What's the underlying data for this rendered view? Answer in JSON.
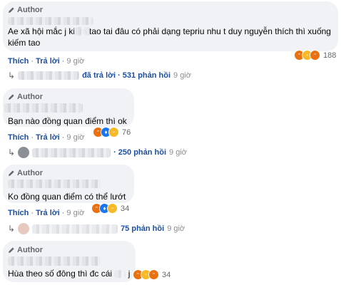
{
  "comments": [
    {
      "author": "Author",
      "text": "Ae xã hội mắc      j kiếm tao tai đâu có phải dạng tepriu nhu t duy nguyễn thích thì xuống kiếm tao",
      "like_label": "Thích",
      "reply_label": "Trả lời",
      "time": "9 giờ",
      "reaction_count": "188",
      "reactions": [
        "angry-icon",
        "haha-icon",
        "angry-icon"
      ],
      "reply_summary": "đã trả lời · 531 phản hồi",
      "reply_time": "9 giờ"
    },
    {
      "author": "Author",
      "text": "Bạn nào đồng quan điểm thì ok",
      "like_label": "Thích",
      "reply_label": "Trả lời",
      "time": "9 giờ",
      "reaction_count": "76",
      "reactions": [
        "angry-icon",
        "like-icon",
        "haha-icon"
      ],
      "reply_summary": "· 250 phản hồi",
      "reply_time": "9 giờ"
    },
    {
      "author": "Author",
      "text": "Ko đồng quan điểm có thể lướt",
      "like_label": "Thích",
      "reply_label": "Trả lời",
      "time": "9 giờ",
      "reaction_count": "34",
      "reactions": [
        "angry-icon",
        "like-icon",
        "haha-icon"
      ],
      "reply_summary": "75 phản hồi",
      "reply_time": "9 giờ"
    },
    {
      "author": "Author",
      "text": "Hùa theo số đông thì đc cái",
      "text_tail": "j",
      "reaction_count": "34",
      "reactions": [
        "angry-icon",
        "haha-icon",
        "angry-icon"
      ]
    }
  ],
  "colors": {
    "link": "#1c4fa1",
    "muted": "#65676b",
    "bubble": "#f0f2f5",
    "angry": "#e9710f",
    "haha": "#f7b928",
    "like": "#1877f2"
  }
}
